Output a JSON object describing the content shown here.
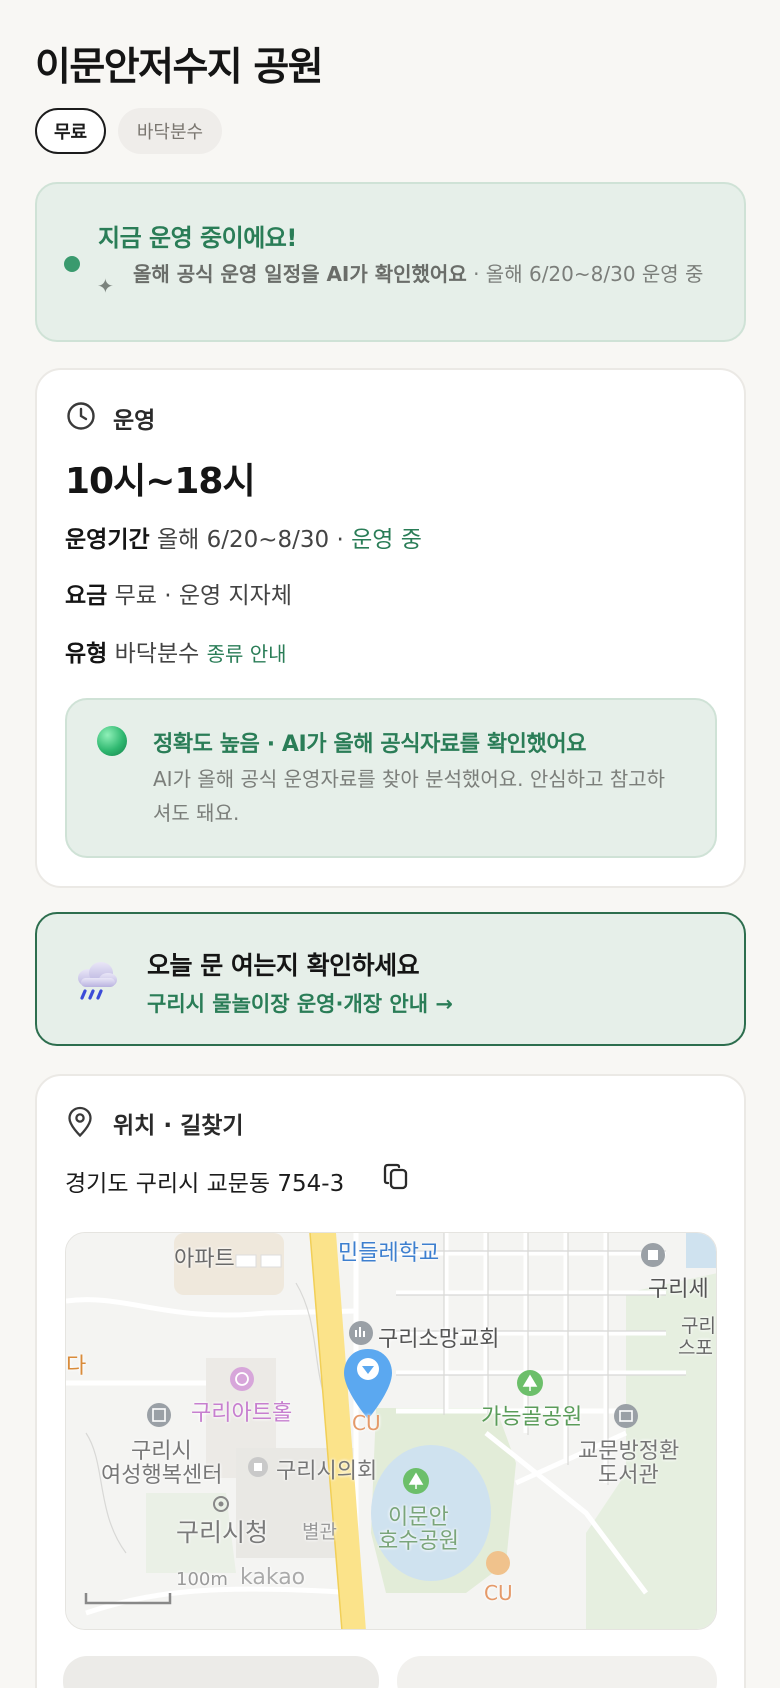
{
  "header": {
    "title": "이문안저수지 공원"
  },
  "chips": {
    "price": "무료",
    "type": "바닥분수"
  },
  "status": {
    "title": "지금 운영 중이에요!",
    "sparkle": "✦",
    "sub_bold": "올해 공식 운영 일정을 AI가 확인했어요",
    "sub_rest": " · 올해 6/20~8/30 운영 중"
  },
  "operation": {
    "label": "운영",
    "hours": "10시~18시",
    "period_key": "운영기간",
    "period_value": " 올해 6/20~8/30 · ",
    "period_status": "운영 중",
    "fee_key": "요금",
    "fee_value": " 무료 · 운영 지자체",
    "type_key": "유형",
    "type_value": " 바닥분수 ",
    "type_link": "종류 안내",
    "accuracy_title": "정확도 높음 · AI가 올해 공식자료를 확인했어요",
    "accuracy_body": "AI가 올해 공식 운영자료를 찾아 분석했어요. 안심하고 참고하셔도 돼요."
  },
  "banner": {
    "title": "오늘 문 여는지 확인하세요",
    "link": "구리시 물놀이장 운영·개장 안내 →"
  },
  "location": {
    "label": "위치 · 길찾기",
    "address": "경기도 구리시 교문동 754-3"
  },
  "map": {
    "labels": {
      "apt": "아파트",
      "school": "민들레학교",
      "guri_se": "구리세",
      "guri_sp1": "구리",
      "guri_sp2": "스포",
      "church": "구리소망교회",
      "arthall": "구리아트홀",
      "park": "가능골공원",
      "cu1": "CU",
      "women1": "구리시",
      "women2": "여성행복센터",
      "council": "구리시의회",
      "library1": "교문방정환",
      "library2": "도서관",
      "cityhall": "구리시청",
      "annex": "별관",
      "lake1": "이문안",
      "lake2": "호수공원",
      "cu2": "CU",
      "da": "다",
      "scale": "100m",
      "logo": "kakao"
    }
  },
  "colors": {
    "accent_green": "#2a7d57",
    "status_bg": "#e6efe9",
    "banner_border": "#2d6e4e"
  }
}
